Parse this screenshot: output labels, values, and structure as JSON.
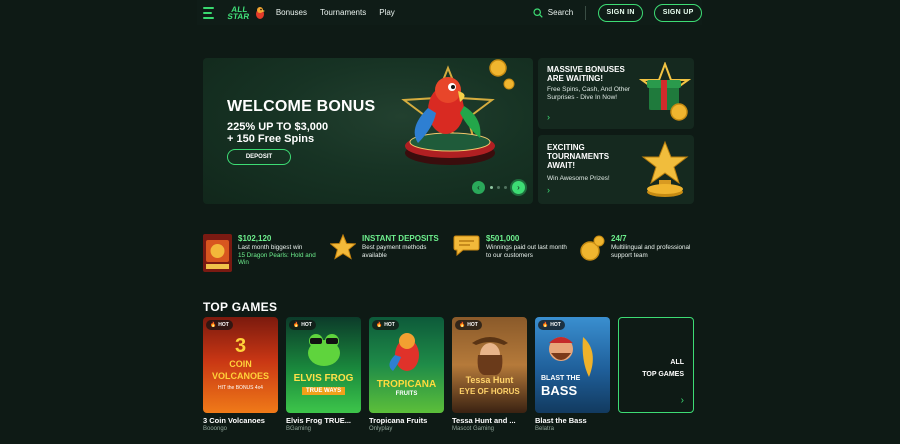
{
  "header": {
    "logo_text": "ALL STAR",
    "nav": [
      "Bonuses",
      "Tournaments",
      "Play"
    ],
    "search_label": "Search",
    "signin_label": "SIGN IN",
    "signup_label": "SIGN UP"
  },
  "hero": {
    "title": "WELCOME BONUS",
    "line1": "225% UP TO $3,000",
    "line2": "+ 150 Free Spins",
    "cta": "DEPOSIT"
  },
  "promos": [
    {
      "title": "MASSIVE BONUSES ARE WAITING!",
      "text": "Free Spins, Cash, And Other Surprises - Dive In Now!"
    },
    {
      "title": "EXCITING TOURNAMENTS AWAIT!",
      "text": "Win Awesome Prizes!"
    }
  ],
  "features": [
    {
      "head": "$102,120",
      "text": "Last month biggest win",
      "link": "15 Dragon Pearls: Hold and Win"
    },
    {
      "head": "INSTANT DEPOSITS",
      "text": "Best payment methods available"
    },
    {
      "head": "$501,000",
      "text": "Winnings paid out last month to our customers"
    },
    {
      "head": "24/7",
      "text": "Multilingual and professional support team"
    }
  ],
  "top_games": {
    "title": "TOP GAMES",
    "hot_label": "HOT",
    "all_label_1": "ALL",
    "all_label_2": "TOP GAMES",
    "games": [
      {
        "name": "3 Coin Volcanoes",
        "provider": "Booongo",
        "art": [
          "3",
          "COIN",
          "VOLCANOES",
          "HIT the BONUS 4x4"
        ]
      },
      {
        "name": "Elvis Frog TRUE...",
        "provider": "BGaming",
        "art": [
          "ELVIS FROG",
          "TRUE WAYS"
        ]
      },
      {
        "name": "Tropicana Fruits",
        "provider": "Onlyplay",
        "art": [
          "TROPICANA",
          "FRUITS"
        ]
      },
      {
        "name": "Tessa Hunt and ...",
        "provider": "Mascot Gaming",
        "art": [
          "Tessa Hunt",
          "EYE OF HORUS"
        ]
      },
      {
        "name": "Blast the Bass",
        "provider": "Belatra",
        "art": [
          "BLAST THE",
          "BASS"
        ]
      }
    ]
  }
}
